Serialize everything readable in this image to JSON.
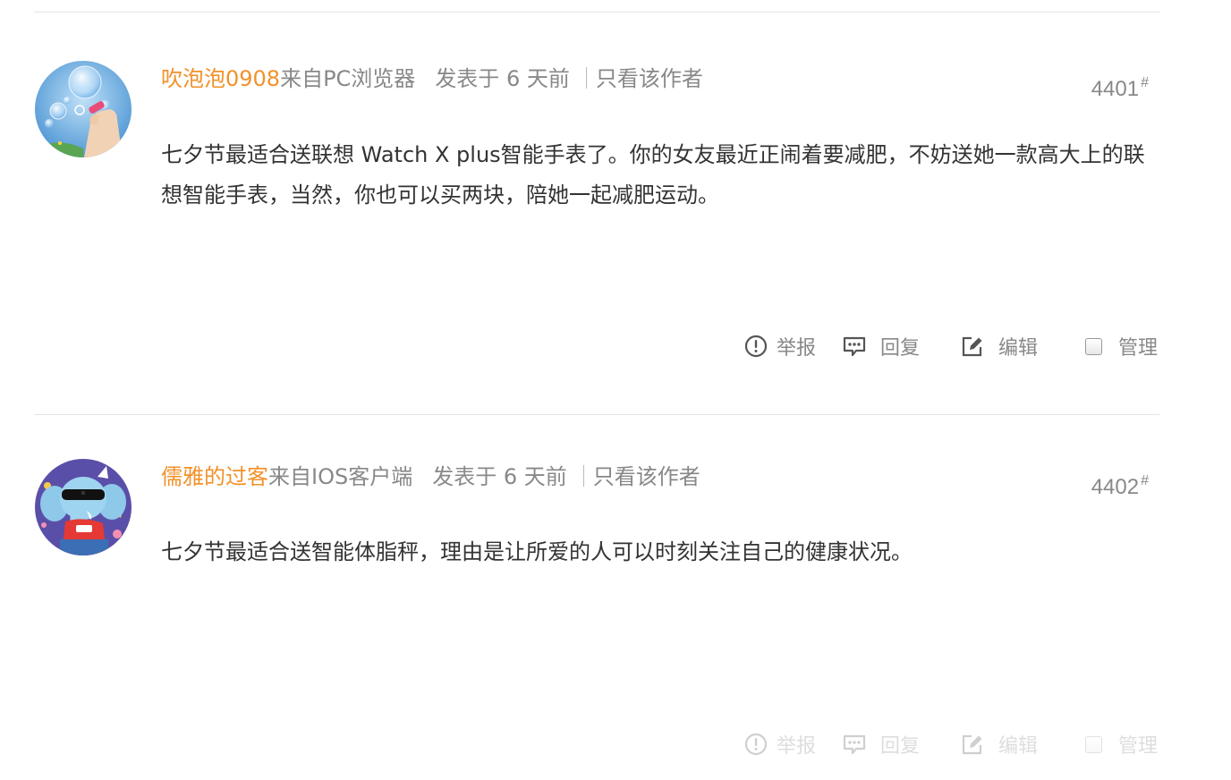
{
  "posts": [
    {
      "author": "吹泡泡0908",
      "source": "来自PC浏览器",
      "posted": "发表于 6 天前",
      "only_author": "只看该作者",
      "floor": "4401",
      "floor_mark": "#",
      "content": "七夕节最适合送联想 Watch X plus智能手表了。你的女友最近正闹着要减肥，不妨送她一款高大上的联想智能手表，当然，你也可以买两块，陪她一起减肥运动。",
      "actions": {
        "report": "举报",
        "reply": "回复",
        "edit": "编辑",
        "manage": "管理"
      },
      "avatar_icon": "bubble-blowing-hand-avatar"
    },
    {
      "author": "儒雅的过客",
      "source": "来自IOS客户端",
      "posted": "发表于 6 天前",
      "only_author": "只看该作者",
      "floor": "4402",
      "floor_mark": "#",
      "content": "七夕节最适合送智能体脂秤，理由是让所爱的人可以时刻关注自己的健康状况。",
      "actions": {
        "report": "举报",
        "reply": "回复",
        "edit": "编辑",
        "manage": "管理"
      },
      "avatar_icon": "cartoon-elephant-avatar"
    }
  ],
  "colors": {
    "author": "#f2912a",
    "meta": "#888888",
    "content": "#333333",
    "divider": "#e4e4e4"
  }
}
